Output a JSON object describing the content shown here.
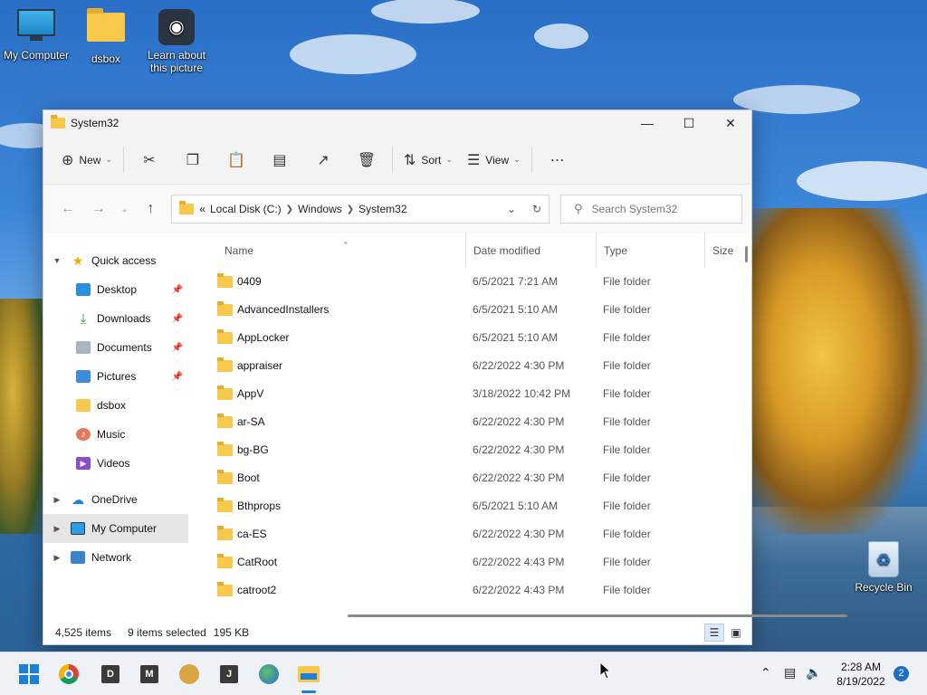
{
  "desktop": {
    "icons": [
      {
        "label": "My Computer"
      },
      {
        "label": "dsbox"
      },
      {
        "label": "Learn about this picture"
      }
    ],
    "recycle_bin": "Recycle Bin"
  },
  "window": {
    "title": "System32",
    "toolbar": {
      "new_label": "New",
      "sort_label": "Sort",
      "view_label": "View"
    },
    "address": {
      "crumbs": [
        "Local Disk (C:)",
        "Windows",
        "System32"
      ],
      "overflow": "«"
    },
    "search": {
      "placeholder": "Search System32"
    },
    "sidebar": {
      "quick_access": "Quick access",
      "items": [
        "Desktop",
        "Downloads",
        "Documents",
        "Pictures",
        "dsbox",
        "Music",
        "Videos"
      ],
      "onedrive": "OneDrive",
      "my_computer": "My Computer",
      "network": "Network"
    },
    "columns": {
      "name": "Name",
      "date": "Date modified",
      "type": "Type",
      "size": "Size"
    },
    "files": [
      {
        "name": "0409",
        "date": "6/5/2021 7:21 AM",
        "type": "File folder"
      },
      {
        "name": "AdvancedInstallers",
        "date": "6/5/2021 5:10 AM",
        "type": "File folder"
      },
      {
        "name": "AppLocker",
        "date": "6/5/2021 5:10 AM",
        "type": "File folder"
      },
      {
        "name": "appraiser",
        "date": "6/22/2022 4:30 PM",
        "type": "File folder"
      },
      {
        "name": "AppV",
        "date": "3/18/2022 10:42 PM",
        "type": "File folder"
      },
      {
        "name": "ar-SA",
        "date": "6/22/2022 4:30 PM",
        "type": "File folder"
      },
      {
        "name": "bg-BG",
        "date": "6/22/2022 4:30 PM",
        "type": "File folder"
      },
      {
        "name": "Boot",
        "date": "6/22/2022 4:30 PM",
        "type": "File folder"
      },
      {
        "name": "Bthprops",
        "date": "6/5/2021 5:10 AM",
        "type": "File folder"
      },
      {
        "name": "ca-ES",
        "date": "6/22/2022 4:30 PM",
        "type": "File folder"
      },
      {
        "name": "CatRoot",
        "date": "6/22/2022 4:43 PM",
        "type": "File folder"
      },
      {
        "name": "catroot2",
        "date": "6/22/2022 4:43 PM",
        "type": "File folder"
      }
    ],
    "status": {
      "count": "4,525 items",
      "selected": "9 items selected",
      "size": "195 KB"
    }
  },
  "taskbar": {
    "letter_apps": [
      "D",
      "M",
      "J"
    ],
    "time": "2:28 AM",
    "date": "8/19/2022",
    "notifications": "2"
  },
  "colors": {
    "accent": "#1e7fd8",
    "folder": "#f7c84a"
  }
}
